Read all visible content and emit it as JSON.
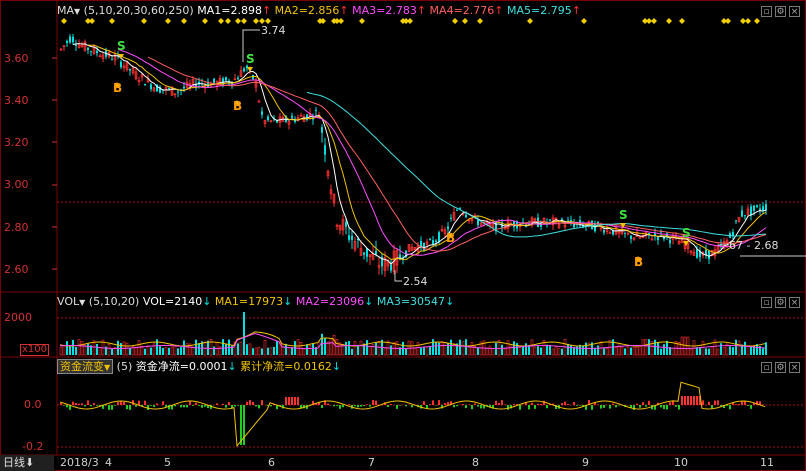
{
  "main_panel": {
    "indicator": "MA",
    "params": "(5,10,20,30,60,250)",
    "ma_values": [
      {
        "label": "MA1=2.898",
        "arrow": "↑",
        "color": "#ffffff"
      },
      {
        "label": "MA2=2.856",
        "arrow": "↑",
        "color": "#f2c200"
      },
      {
        "label": "MA3=2.783",
        "arrow": "↑",
        "color": "#ff4cff"
      },
      {
        "label": "MA4=2.776",
        "arrow": "↑",
        "color": "#ff6060"
      },
      {
        "label": "MA5=2.795",
        "arrow": "↑",
        "color": "#40e0e0"
      }
    ],
    "price_high_label": "3.74",
    "price_low_label": "2.54",
    "range_label": "67 - 2.68",
    "y_ticks": [
      "3.60",
      "3.40",
      "3.20",
      "3.00",
      "2.80",
      "2.60"
    ]
  },
  "volume_panel": {
    "indicator": "VOL",
    "params": "(5,10,20)",
    "values": [
      {
        "label": "VOL=2140",
        "arrow": "↓",
        "color": "#ffffff"
      },
      {
        "label": "MA1=17973",
        "arrow": "↓",
        "color": "#f2c200"
      },
      {
        "label": "MA2=23096",
        "arrow": "↓",
        "color": "#ff4cff"
      },
      {
        "label": "MA3=30547",
        "arrow": "↓",
        "color": "#40e0e0"
      }
    ],
    "y_tick": "2000",
    "unit_label": "x100"
  },
  "fund_panel": {
    "indicator": "资金流变",
    "params": "(5)",
    "values": [
      {
        "label": "资金净流=0.0001",
        "arrow": "↓",
        "color": "#ffffff"
      },
      {
        "label": "累计净流=0.0162",
        "arrow": "↓",
        "color": "#f2c200"
      }
    ],
    "y_ticks": [
      "0.0",
      "-0.2"
    ]
  },
  "x_axis": {
    "period": "日线",
    "labels": [
      "2018/3",
      "4",
      "5",
      "6",
      "7",
      "8",
      "9",
      "10",
      "11"
    ]
  },
  "signals": {
    "buy": "B",
    "sell": "S"
  },
  "colors": {
    "up": "#ff3232",
    "down": "#00e0e0",
    "grid": "#7a0000",
    "ma1": "#ffffff",
    "ma2": "#f2c200",
    "ma3": "#ff4cff",
    "ma4": "#ff6060",
    "ma5": "#40e0e0"
  },
  "icons": [
    "maximize-icon",
    "settings-icon",
    "close-icon",
    "chevron-down-icon"
  ]
}
